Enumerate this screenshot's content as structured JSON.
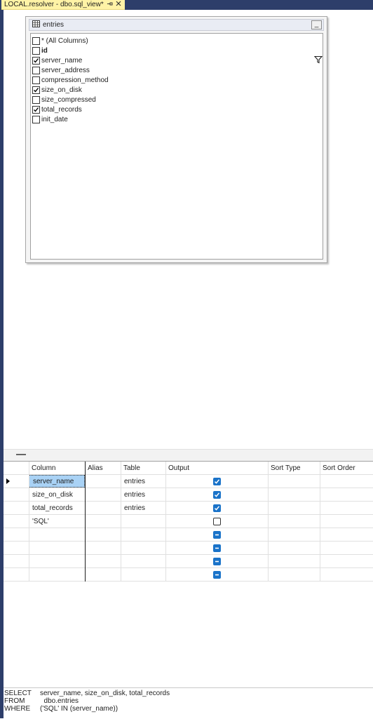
{
  "tab": {
    "title": "LOCAL.resolver - dbo.sql_view*",
    "pin_icon": "pin-icon",
    "close_icon": "close-icon"
  },
  "diagram": {
    "table_name": "entries",
    "table_icon": "table-grid-icon",
    "minimize_label": "_",
    "columns": [
      {
        "label": "* (All Columns)",
        "checked": false,
        "bold": false,
        "filter": false
      },
      {
        "label": "id",
        "checked": false,
        "bold": true,
        "filter": false
      },
      {
        "label": "server_name",
        "checked": true,
        "bold": false,
        "filter": true
      },
      {
        "label": "server_address",
        "checked": false,
        "bold": false,
        "filter": false
      },
      {
        "label": "compression_method",
        "checked": false,
        "bold": false,
        "filter": false
      },
      {
        "label": "size_on_disk",
        "checked": true,
        "bold": false,
        "filter": false
      },
      {
        "label": "size_compressed",
        "checked": false,
        "bold": false,
        "filter": false
      },
      {
        "label": "total_records",
        "checked": true,
        "bold": false,
        "filter": false
      },
      {
        "label": "init_date",
        "checked": false,
        "bold": false,
        "filter": false
      }
    ]
  },
  "grid": {
    "headers": {
      "column": "Column",
      "alias": "Alias",
      "table": "Table",
      "output": "Output",
      "sort_type": "Sort Type",
      "sort_order": "Sort Order"
    },
    "rows": [
      {
        "column": "server_name",
        "alias": "",
        "table": "entries",
        "output": "checked",
        "selected": true
      },
      {
        "column": "size_on_disk",
        "alias": "",
        "table": "entries",
        "output": "checked",
        "selected": false
      },
      {
        "column": "total_records",
        "alias": "",
        "table": "entries",
        "output": "checked",
        "selected": false
      },
      {
        "column": "'SQL'",
        "alias": "",
        "table": "",
        "output": "unchecked",
        "selected": false
      },
      {
        "column": "",
        "alias": "",
        "table": "",
        "output": "indeterminate",
        "selected": false
      },
      {
        "column": "",
        "alias": "",
        "table": "",
        "output": "indeterminate",
        "selected": false
      },
      {
        "column": "",
        "alias": "",
        "table": "",
        "output": "indeterminate",
        "selected": false
      },
      {
        "column": "",
        "alias": "",
        "table": "",
        "output": "indeterminate",
        "selected": false
      }
    ]
  },
  "sql": {
    "lines": [
      {
        "keyword": "SELECT",
        "text": "server_name, size_on_disk, total_records"
      },
      {
        "keyword": "FROM",
        "text": "  dbo.entries"
      },
      {
        "keyword": "WHERE",
        "text": "('SQL' IN (server_name))"
      }
    ]
  },
  "colors": {
    "chrome": "#2d3e6a",
    "tab": "#fff3a6",
    "check_blue": "#1a73c9",
    "selection": "#a9d2f5"
  }
}
